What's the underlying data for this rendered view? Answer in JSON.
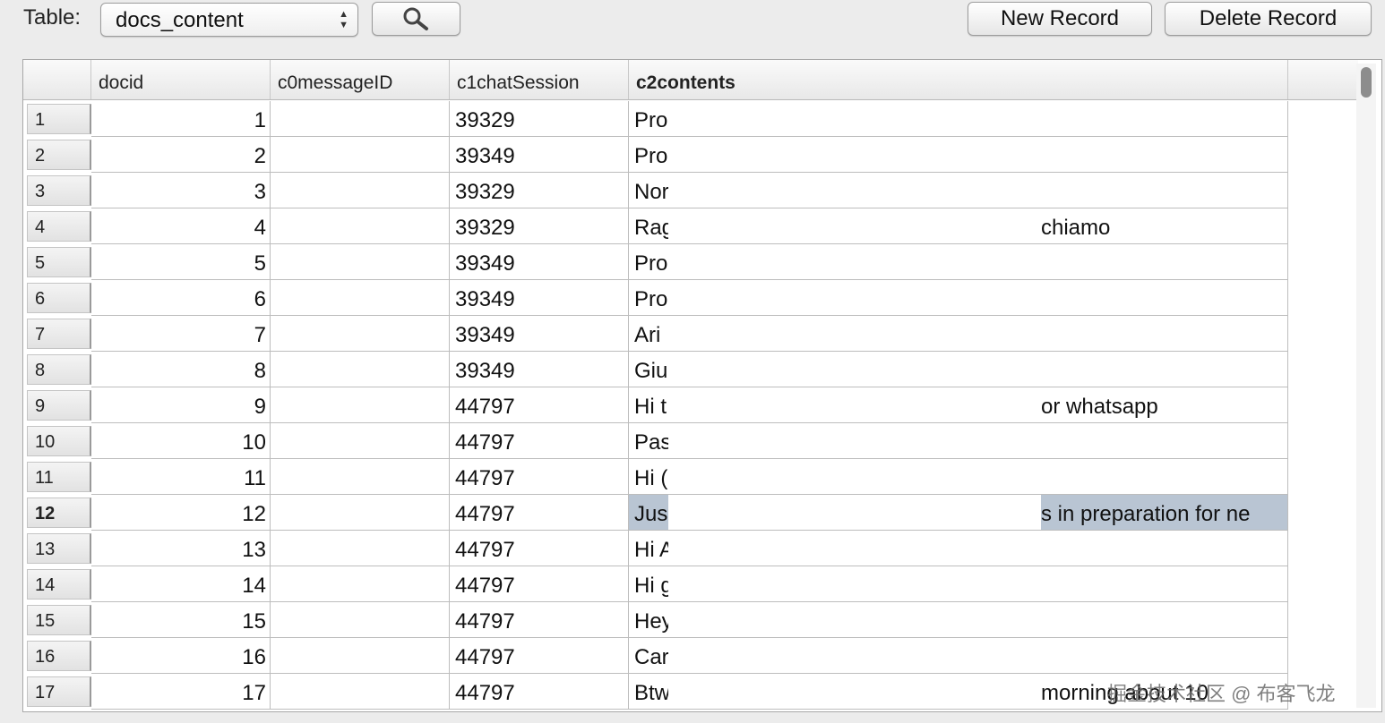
{
  "toolbar": {
    "table_label": "Table:",
    "table_select": "docs_content",
    "new_record_label": "New Record",
    "delete_record_label": "Delete Record"
  },
  "columns": [
    "docid",
    "c0messageID",
    "c1chatSession",
    "c2contents"
  ],
  "rows": [
    {
      "num": "1",
      "docid": "1",
      "msg": "",
      "session": "39329",
      "c_left": "Pro",
      "c_right": ""
    },
    {
      "num": "2",
      "docid": "2",
      "msg": "",
      "session": "39349",
      "c_left": "Pro",
      "c_right": ""
    },
    {
      "num": "3",
      "docid": "3",
      "msg": "",
      "session": "39329",
      "c_left": "Nor",
      "c_right": ""
    },
    {
      "num": "4",
      "docid": "4",
      "msg": "",
      "session": "39329",
      "c_left": "Rag",
      "c_right": "chiamo"
    },
    {
      "num": "5",
      "docid": "5",
      "msg": "",
      "session": "39349",
      "c_left": "Pro",
      "c_right": ""
    },
    {
      "num": "6",
      "docid": "6",
      "msg": "",
      "session": "39349",
      "c_left": "Pro",
      "c_right": ""
    },
    {
      "num": "7",
      "docid": "7",
      "msg": "",
      "session": "39349",
      "c_left": "Ari",
      "c_right": ""
    },
    {
      "num": "8",
      "docid": "8",
      "msg": "",
      "session": "39349",
      "c_left": "Giu",
      "c_right": ""
    },
    {
      "num": "9",
      "docid": "9",
      "msg": "",
      "session": "44797",
      "c_left": "Hi t",
      "c_right": "or whatsapp"
    },
    {
      "num": "10",
      "docid": "10",
      "msg": "",
      "session": "44797",
      "c_left": "Pas",
      "c_right": ""
    },
    {
      "num": "11",
      "docid": "11",
      "msg": "",
      "session": "44797",
      "c_left": "Hi (",
      "c_right": ""
    },
    {
      "num": "12",
      "docid": "12",
      "msg": "",
      "session": "44797",
      "c_left": "Jus",
      "c_right": "s in preparation for ne"
    },
    {
      "num": "13",
      "docid": "13",
      "msg": "",
      "session": "44797",
      "c_left": "Hi A",
      "c_right": ""
    },
    {
      "num": "14",
      "docid": "14",
      "msg": "",
      "session": "44797",
      "c_left": "Hi g",
      "c_right": ""
    },
    {
      "num": "15",
      "docid": "15",
      "msg": "",
      "session": "44797",
      "c_left": "Hey",
      "c_right": ""
    },
    {
      "num": "16",
      "docid": "16",
      "msg": "",
      "session": "44797",
      "c_left": "Car",
      "c_right": ""
    },
    {
      "num": "17",
      "docid": "17",
      "msg": "",
      "session": "44797",
      "c_left": "Btw",
      "c_right": "morning about 10"
    }
  ],
  "selected_row": "12",
  "watermark": "掘金技术社区 @ 布客飞龙"
}
